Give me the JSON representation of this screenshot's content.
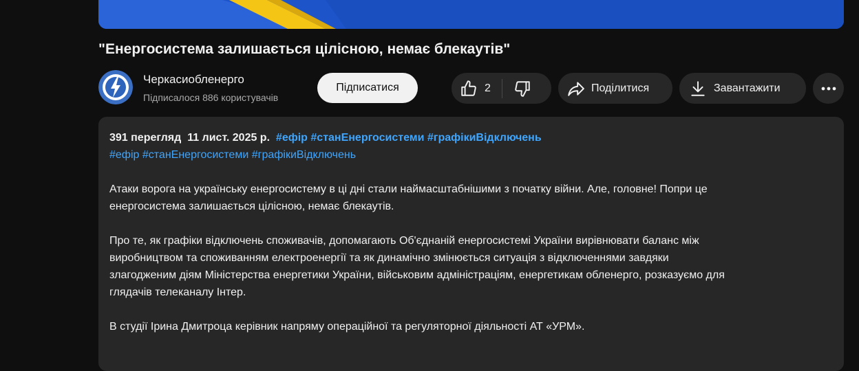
{
  "video": {
    "title": "\"Енергосистема залишається цілісною, немає блекаутів\""
  },
  "channel": {
    "name": "Черкасиобленерго",
    "subscribers": "Підписалося 886 користувачів",
    "avatar_icon": "lightning-logo-icon"
  },
  "actions": {
    "subscribe_label": "Підписатися",
    "like_count": "2",
    "share_label": "Поділитися",
    "download_label": "Завантажити",
    "like_icon": "thumbs-up-icon",
    "dislike_icon": "thumbs-down-icon",
    "share_icon": "share-arrow-icon",
    "download_icon": "download-icon",
    "more_icon": "more-horizontal-icon"
  },
  "description": {
    "views": "391 перегляд",
    "date": "11 лист. 2025 р.",
    "header_tags": [
      "#ефір",
      "#станЕнергосистеми",
      "#графікиВідключень"
    ],
    "tags": [
      "#ефір",
      "#станЕнергосистеми",
      "#графікиВідключень"
    ],
    "paragraph_1_line_1": "Атаки ворога на українську енергосистему в ці дні стали наймасштабнішими з початку війни. Але, головне! Попри це",
    "paragraph_1_line_2": "енергосистема залишається цілісною, немає блекаутів.",
    "paragraph_2_line_1": "Про те, як графіки відключень споживачів, допомагають Об'єднаній енергосистемі України вирівнювати баланс між",
    "paragraph_2_line_2": "виробництвом та споживанням електроенергії та як динамічно змінюється ситуація з відключеннями завдяки",
    "paragraph_2_line_3": "злагодженим діям Міністерства енергетики України, військовим адміністраціям, енергетикам обленерго, розказуємо для",
    "paragraph_2_line_4": "глядачів телеканалу Інтер.",
    "paragraph_3_line_1": "В студії Ірина Дмитроца керівник напряму операційної та регуляторної діяльності АТ «УРМ»."
  },
  "colors": {
    "background": "#0f0f0f",
    "surface": "#272727",
    "link": "#3ea6ff",
    "flag_blue": "#1d54c9",
    "flag_yellow": "#f5c516"
  }
}
